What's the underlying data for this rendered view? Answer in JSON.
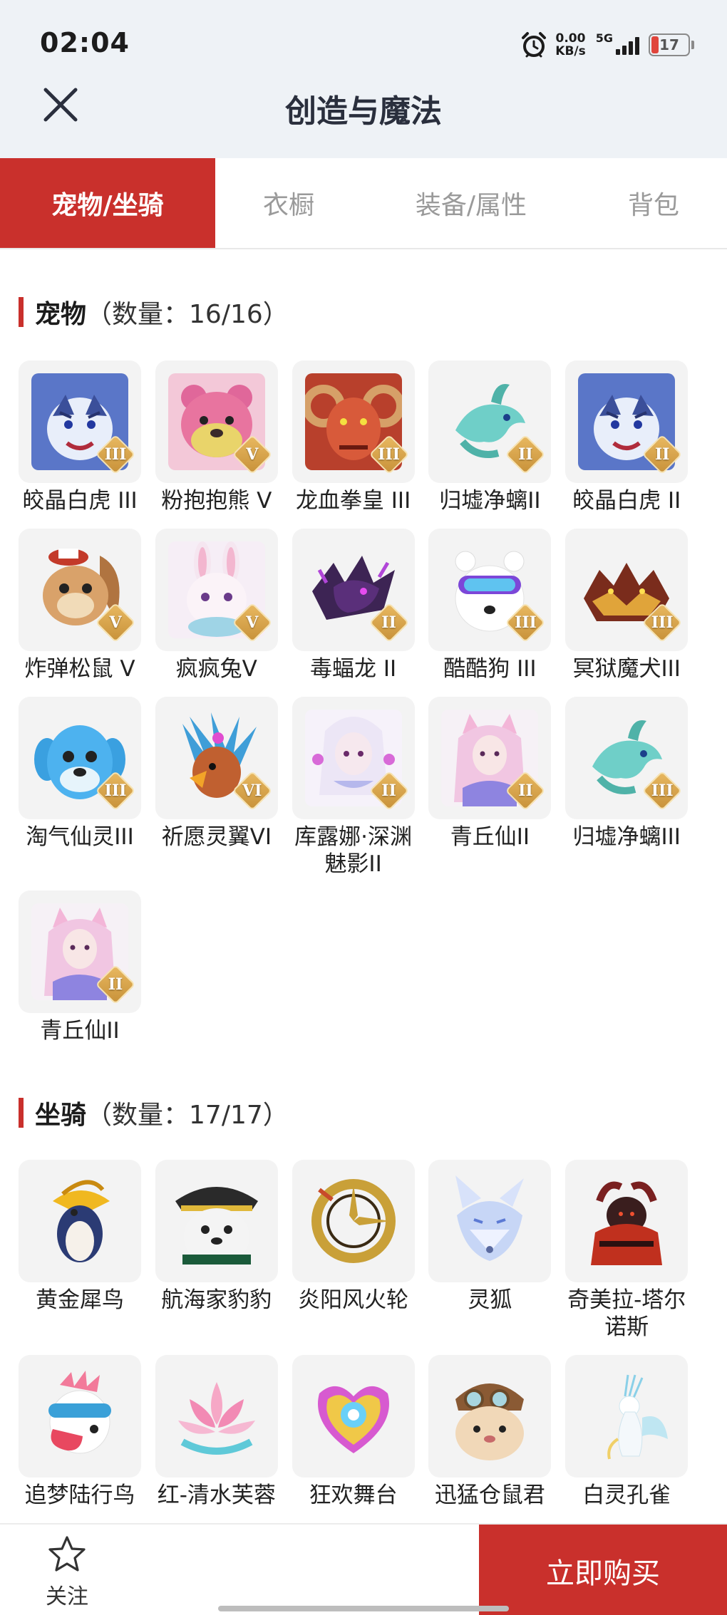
{
  "status": {
    "time": "02:04",
    "speed_value": "0.00",
    "speed_unit": "KB/s",
    "network": "5G",
    "battery": "17",
    "alarm_icon": "alarm-clock-icon",
    "signal_icon": "signal-bars-icon"
  },
  "header": {
    "close_icon": "close-icon",
    "title": "创造与魔法"
  },
  "tabs": [
    {
      "label": "宠物/坐骑",
      "active": true
    },
    {
      "label": "衣橱",
      "active": false
    },
    {
      "label": "装备/属性",
      "active": false
    },
    {
      "label": "背包",
      "active": false
    }
  ],
  "pets": {
    "title": "宠物",
    "count": "（数量：16/16）",
    "items": [
      {
        "name": "皎晶白虎 III",
        "rank": "III",
        "art": "tiger"
      },
      {
        "name": "粉抱抱熊 V",
        "rank": "V",
        "art": "bear"
      },
      {
        "name": "龙血拳皇 III",
        "rank": "III",
        "art": "ram"
      },
      {
        "name": "归墟净螭II",
        "rank": "II",
        "art": "dragon"
      },
      {
        "name": "皎晶白虎 II",
        "rank": "II",
        "art": "tiger"
      },
      {
        "name": "炸弹松鼠 V",
        "rank": "V",
        "art": "squirrel"
      },
      {
        "name": "疯疯兔V",
        "rank": "V",
        "art": "rabbit"
      },
      {
        "name": "毒蝠龙 II",
        "rank": "II",
        "art": "batdragon"
      },
      {
        "name": "酷酷狗 III",
        "rank": "III",
        "art": "dog"
      },
      {
        "name": "冥狱魔犬III",
        "rank": "III",
        "art": "hellhound"
      },
      {
        "name": "淘气仙灵III",
        "rank": "III",
        "art": "blueimp"
      },
      {
        "name": "祈愿灵翼VI",
        "rank": "VI",
        "art": "phoenix"
      },
      {
        "name": "库露娜·深渊魅影II",
        "rank": "II",
        "art": "spirit"
      },
      {
        "name": "青丘仙II",
        "rank": "II",
        "art": "foxgirl"
      },
      {
        "name": "归墟净螭III",
        "rank": "III",
        "art": "dragon"
      },
      {
        "name": "青丘仙II",
        "rank": "II",
        "art": "foxgirl"
      }
    ]
  },
  "mounts": {
    "title": "坐骑",
    "count": "（数量：17/17）",
    "items": [
      {
        "name": "黄金犀鸟",
        "art": "hornbill"
      },
      {
        "name": "航海家豹豹",
        "art": "pirate"
      },
      {
        "name": "炎阳风火轮",
        "art": "wheel"
      },
      {
        "name": "灵狐",
        "art": "fox"
      },
      {
        "name": "奇美拉-塔尔诺斯",
        "art": "chimera"
      },
      {
        "name": "追梦陆行鸟",
        "art": "chocobo"
      },
      {
        "name": "红-清水芙蓉",
        "art": "lotus"
      },
      {
        "name": "狂欢舞台",
        "art": "stage"
      },
      {
        "name": "迅猛仓鼠君",
        "art": "hamster"
      },
      {
        "name": "白灵孔雀",
        "art": "peacock"
      }
    ]
  },
  "footer": {
    "follow_icon": "star-outline-icon",
    "follow_label": "关注",
    "buy_label": "立即购买"
  },
  "colors": {
    "accent": "#c9302c",
    "rank_gold": "#c8923a"
  }
}
